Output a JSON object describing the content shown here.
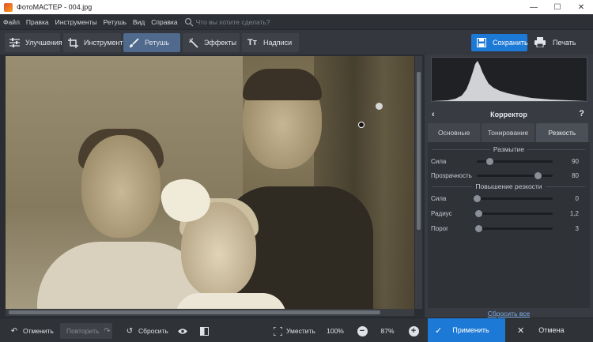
{
  "window": {
    "title": "ФотоМАСТЕР - 004.jpg",
    "minimize": "—",
    "maximize": "☐",
    "close": "✕"
  },
  "menu": {
    "items": [
      "Файл",
      "Правка",
      "Инструменты",
      "Ретушь",
      "Вид",
      "Справка"
    ],
    "search_placeholder": "Что вы хотите сделать?"
  },
  "tabs": [
    {
      "label": "Улучшения",
      "icon": "sliders-icon"
    },
    {
      "label": "Инструменты",
      "icon": "crop-icon"
    },
    {
      "label": "Ретушь",
      "icon": "brush-icon",
      "active": true
    },
    {
      "label": "Эффекты",
      "icon": "magic-wand-icon"
    },
    {
      "label": "Надписи",
      "icon": "text-icon"
    }
  ],
  "toolbar": {
    "save_label": "Сохранить",
    "print_label": "Печать"
  },
  "panel": {
    "title": "Корректор",
    "back": "‹",
    "help": "?",
    "subtabs": [
      "Основные",
      "Тонирование",
      "Резкость"
    ],
    "active_subtab": "Резкость",
    "blur_group": "Размытие",
    "sharpen_group": "Повышение резкости",
    "blur_strength_label": "Сила",
    "blur_strength_value": "90",
    "blur_strength_fraction": 0.17,
    "transparency_label": "Прозрачность",
    "transparency_value": "80",
    "transparency_fraction": 0.8,
    "sharp_strength_label": "Сила",
    "sharp_strength_value": "0",
    "sharp_strength_fraction": 0,
    "radius_label": "Радиус",
    "radius_value": "1,2",
    "radius_fraction": 0.02,
    "threshold_label": "Порог",
    "threshold_value": "3",
    "threshold_fraction": 0.02,
    "reset_all": "Сбросить все"
  },
  "bottom": {
    "undo": "Отменить",
    "redo": "Повторить",
    "reset": "Сбросить",
    "fit": "Уместить",
    "zoom_100": "100%",
    "zoom_minus": "−",
    "zoom_value": "87%",
    "zoom_plus": "+",
    "apply": "Применить",
    "cancel": "Отмена"
  },
  "colors": {
    "accent": "#1d79d6",
    "active_tab": "#4f6a8c",
    "link": "#7fb0ea"
  }
}
